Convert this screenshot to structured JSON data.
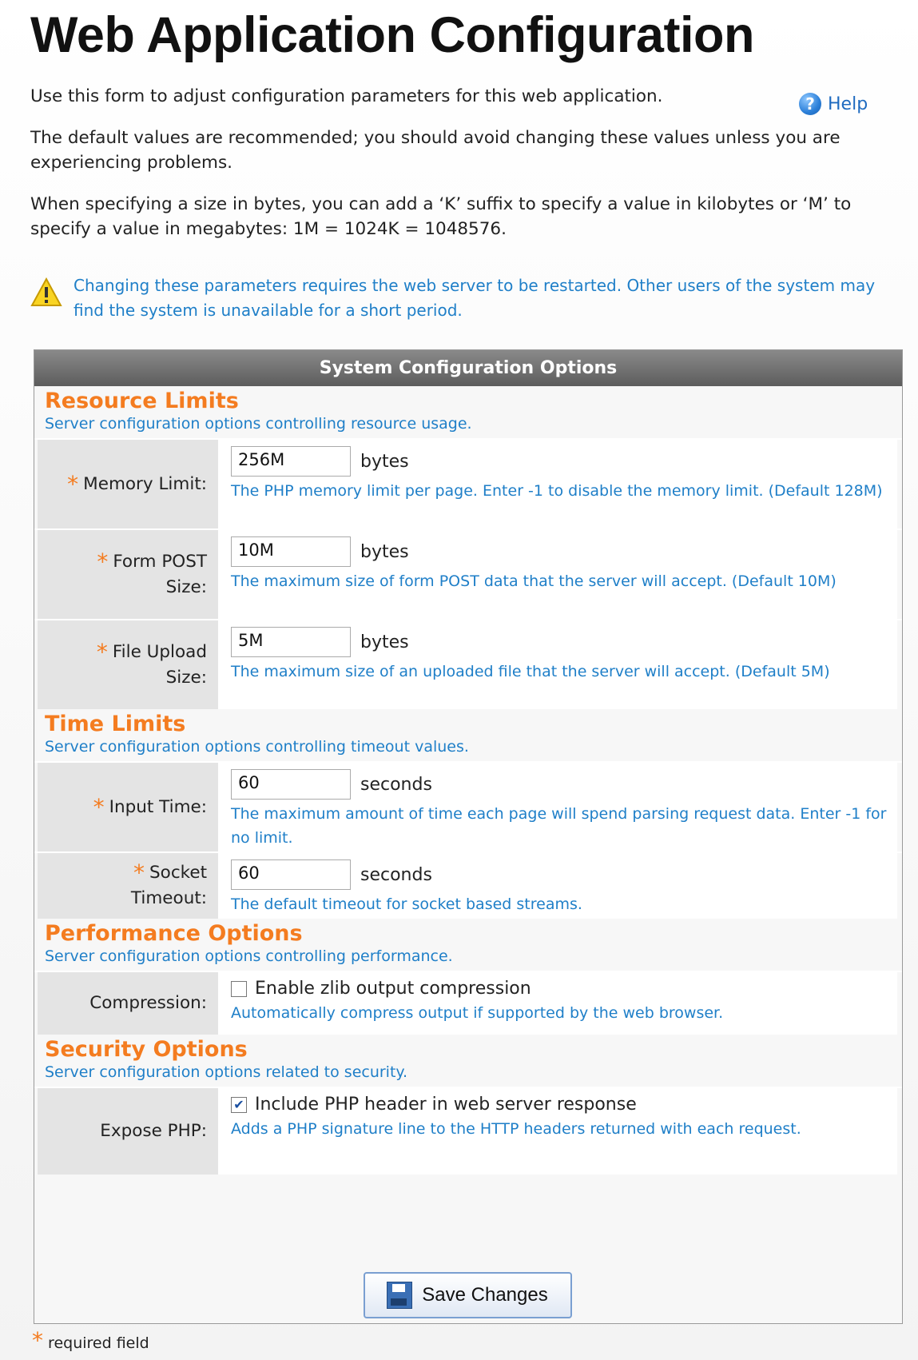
{
  "page": {
    "title": "Web Application Configuration",
    "intro1": "Use this form to adjust configuration parameters for this web application.",
    "help_label": "Help",
    "intro2": "The default values are recommended; you should avoid changing these values unless you are experiencing problems.",
    "intro3": "When specifying a size in bytes, you can add a ‘K’ suffix to specify a value in kilobytes or ‘M’ to specify a value in megabytes: 1M = 1024K = 1048576.",
    "warning": "Changing these parameters requires the web server to be restarted. Other users of the system may find the system is unavailable for a short period."
  },
  "panel": {
    "header": "System Configuration Options",
    "resource": {
      "title": "Resource Limits",
      "desc": "Server configuration options controlling resource usage.",
      "memory": {
        "label": "Memory Limit:",
        "value": "256M",
        "unit": "bytes",
        "hint": "The PHP memory limit per page. Enter -1 to disable the memory limit. (Default 128M)"
      },
      "post": {
        "label1": "Form POST",
        "label2": "Size:",
        "value": "10M",
        "unit": "bytes",
        "hint": "The maximum size of form POST data that the server will accept. (Default 10M)"
      },
      "upload": {
        "label1": "File Upload",
        "label2": "Size:",
        "value": "5M",
        "unit": "bytes",
        "hint": "The maximum size of an uploaded file that the server will accept. (Default 5M)"
      }
    },
    "time": {
      "title": "Time Limits",
      "desc": "Server configuration options controlling timeout values.",
      "input": {
        "label": "Input Time:",
        "value": "60",
        "unit": "seconds",
        "hint": "The maximum amount of time each page will spend parsing request data. Enter -1 for no limit."
      },
      "socket": {
        "label1": "Socket",
        "label2": "Timeout:",
        "value": "60",
        "unit": "seconds",
        "hint": "The default timeout for socket based streams."
      }
    },
    "performance": {
      "title": "Performance Options",
      "desc": "Server configuration options controlling performance.",
      "compression": {
        "label": "Compression:",
        "checkbox": "Enable zlib output compression",
        "checked": false,
        "hint": "Automatically compress output if supported by the web browser."
      }
    },
    "security": {
      "title": "Security Options",
      "desc": "Server configuration options related to security.",
      "expose": {
        "label": "Expose PHP:",
        "checkbox": "Include PHP header in web server response",
        "checked": true,
        "hint": "Adds a PHP signature line to the HTTP headers returned with each request."
      }
    },
    "save_label": "Save Changes"
  },
  "footer": {
    "required_note": "required field"
  }
}
